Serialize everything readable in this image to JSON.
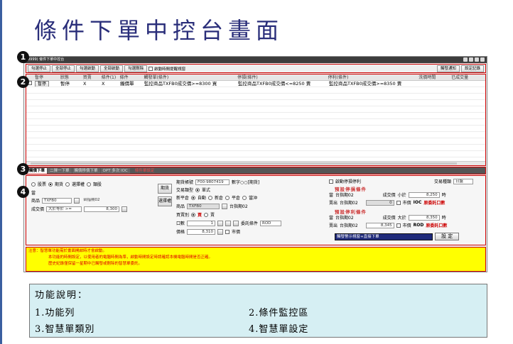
{
  "slide": {
    "title": "條件下單中控台畫面"
  },
  "window": {
    "title": "(9999) 條件下單中控台"
  },
  "toolbar": {
    "buttons": [
      "勾選停止",
      "全部停止",
      "勾選啟動",
      "全部啟動",
      "勾選刪除"
    ],
    "checkbox_label": "啟動時間提醒視窗",
    "right_buttons": [
      "觸發通知",
      "設定記錄"
    ]
  },
  "grid": {
    "headers": [
      "",
      "暫停",
      "狀態",
      "買賣",
      "條件(1)",
      "條件",
      "觸發單(條件)",
      "停損(條件)",
      "停利(條件)",
      "洗價時間",
      "已成交量"
    ],
    "rows": [
      {
        "pause_label": "暫停",
        "status": "暫停",
        "side": "X",
        "cond1": "X",
        "type": "觸價單",
        "trigger": "監控商品TXFB0成交價>=8300 買",
        "stop_loss": "監控商品TXFB0成交價<=8250 賣",
        "take_profit": "監控商品TXFB0成交價>=8350 賣"
      }
    ]
  },
  "tabs": {
    "items": [
      "觸價下單",
      "二擇一下單",
      "觸價移價下單",
      "OPT 多次 IOC"
    ],
    "note": "條件單設定"
  },
  "settings": {
    "market_radios": [
      "股票",
      "期貨",
      "選擇權",
      "類股"
    ],
    "when_label": "當",
    "product_label": "商品",
    "product_code": "TXFB0",
    "product_name": "台指期02",
    "price_label": "成交價",
    "price_cond": "大於等於 >=",
    "price_value": "8,300",
    "side_buttons": [
      "期貨",
      "選擇權"
    ],
    "account_label": "期貨帳號",
    "account_value": "F00-9807419",
    "account_owner": "數字○○[期貨]",
    "trade_type_label": "交易類型",
    "trade_type_value": "單式",
    "open_close_label": "新平倉",
    "open_close_options": [
      "自動",
      "新倉",
      "平倉",
      "當沖"
    ],
    "item_label": "商品",
    "item_code": "TXFB0",
    "item_name": "台指期02",
    "bs_label": "買賣別",
    "bs_options": [
      "買",
      "賣"
    ],
    "qty_label": "口數",
    "qty_value": "1",
    "order_cond_label": "委託條件",
    "order_cond_value": "ROD",
    "price2_label": "價格",
    "price2_value": "8,310",
    "market_price_label": "市價",
    "trigger_check_label": "啟動停損停利",
    "trade_session_label": "交易種類",
    "trade_session_value": "日盤",
    "stop_loss_title": "預設停損條件",
    "sl_when": "當",
    "sl_product": "台指期02",
    "sl_price_label": "成交價",
    "sl_cond": "小於",
    "sl_value": "8,250",
    "sl_time": "時",
    "sl_sell": "賣出",
    "sl_sell_product": "台指期02",
    "sl_qty": "0",
    "sl_market": "市價",
    "sl_ioc": "IOC",
    "sl_note": "原委託口數",
    "take_profit_title": "預設停利條件",
    "tp_when": "當",
    "tp_product": "台指期02",
    "tp_price_label": "成交價",
    "tp_cond": "大於",
    "tp_value": "8,350",
    "tp_time": "時",
    "tp_sell": "賣出",
    "tp_sell_product": "台指期02",
    "tp_price": "8,345",
    "tp_market": "市價",
    "tp_rod": "ROD",
    "tp_note": "原委託口數",
    "alert_select": "觸發警示視窗+直接下單",
    "set_button": "設 定"
  },
  "notice": {
    "lines": [
      "注意：智慧單功能需於畫面開啟時才會啟動。",
      "本功能的時間設定，以使用者的電腦時間為準，啟動時間設定時請確認本機電腦時間是否正確。",
      "歷史紀錄僅保留一星期中已觸發或刪除的智慧單委託。"
    ]
  },
  "badges": [
    "1",
    "2",
    "3",
    "4"
  ],
  "description": {
    "heading": "功能說明：",
    "items": [
      "1.功能列",
      "2.條件監控區",
      "3.智慧單類別",
      "4.智慧單設定"
    ]
  }
}
